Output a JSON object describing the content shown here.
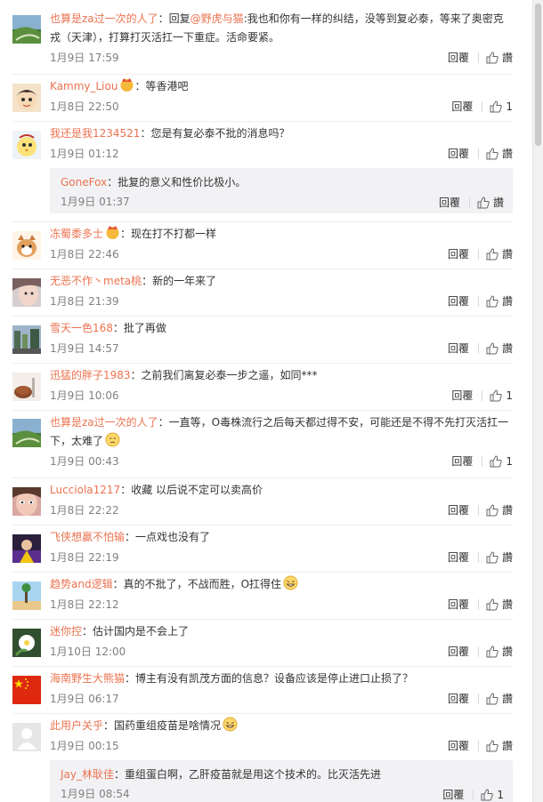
{
  "colors": {
    "link": "#eb7350",
    "time": "#808080",
    "text": "#333333",
    "sub_bg": "#f2f2f5"
  },
  "comments": [
    {
      "user": "也算是za过一次的人了",
      "content_pre": "：回复",
      "mention": "@野虎与猫",
      "content": ":我也和你有一样的纠结，没等到复必泰，等来了奥密克戎（天津），打算打灭活扛一下重症。活命要紧。",
      "time": "1月9日 17:59",
      "reply_label": "回覆",
      "like": "讚",
      "avatar": "landscape-avatar"
    },
    {
      "user": "Kammy_Liou",
      "content": "：等香港吧",
      "time": "1月8日 22:50",
      "reply_label": "回覆",
      "like": "1",
      "avatar": "cartoon-avatar"
    },
    {
      "user": "我还是我1234521",
      "content": "：您是有复必泰不批的消息吗？",
      "time": "1月9日 01:12",
      "reply_label": "回覆",
      "like": "讚",
      "avatar": "chick-avatar",
      "sub": {
        "user": "GoneFox",
        "content": "：批复的意义和性价比极小。",
        "time": "1月9日 01:37",
        "reply_label": "回覆",
        "like": "讚"
      }
    },
    {
      "user": "冻蜀黍多士",
      "content": "：现在打不打都一样",
      "time": "1月8日 22:46",
      "reply_label": "回覆",
      "like": "讚",
      "avatar": "dog-avatar"
    },
    {
      "user": "无恶不作丶meta桃",
      "content": "：新的一年来了",
      "time": "1月8日 21:39",
      "reply_label": "回覆",
      "like": "讚",
      "avatar": "face-avatar"
    },
    {
      "user": "雪天一色168",
      "content": "：批了再做",
      "time": "1月9日 14:57",
      "reply_label": "回覆",
      "like": "讚",
      "avatar": "street-avatar"
    },
    {
      "user": "迅猛的胖子1983",
      "content": "：之前我们离复必泰一步之遥，如同***",
      "time": "1月9日 10:06",
      "reply_label": "回覆",
      "like": "1",
      "avatar": "cookie-avatar"
    },
    {
      "user": "也算是za过一次的人了",
      "content": "：一直等，O毒株流行之后每天都过得不安，可能还是不得不先打灭活扛一下，太难了",
      "time": "1月9日 00:43",
      "reply_label": "回覆",
      "like": "1",
      "avatar": "landscape-avatar"
    },
    {
      "user": "Lucciola1217",
      "content": "：收藏 以后说不定可以卖高价",
      "time": "1月8日 22:22",
      "reply_label": "回覆",
      "like": "讚",
      "avatar": "portrait-avatar"
    },
    {
      "user": "飞侠想赢不怕输",
      "content": "：一点戏也没有了",
      "time": "1月8日 22:19",
      "reply_label": "回覆",
      "like": "讚",
      "avatar": "purple-avatar"
    },
    {
      "user": "趋势and逻辑",
      "content": "：真的不批了，不战而胜，O扛得住",
      "time": "1月8日 22:12",
      "reply_label": "回覆",
      "like": "讚",
      "avatar": "sky-avatar"
    },
    {
      "user": "迷你控",
      "content": "：估计国内是不会上了",
      "time": "1月10日 12:00",
      "reply_label": "回覆",
      "like": "讚",
      "avatar": "flower-avatar"
    },
    {
      "user": "海南野生大熊猫",
      "content": "：博主有没有凯茂方面的信息？设备应该是停止进口止损了？",
      "time": "1月9日 06:17",
      "reply_label": "回覆",
      "like": "讚",
      "avatar": "flag-avatar"
    },
    {
      "user": "此用户关乎",
      "content": "：国药重组疫苗是啥情况",
      "time": "1月9日 00:15",
      "reply_label": "回覆",
      "like": "讚",
      "avatar": "default-avatar",
      "sub": {
        "user": "Jay_林耿佳",
        "content": "：重组蛋白啊，乙肝疫苗就是用这个技术的。比灭活先进",
        "time": "1月9日 08:54",
        "reply_label": "回覆",
        "like": "1"
      }
    }
  ]
}
